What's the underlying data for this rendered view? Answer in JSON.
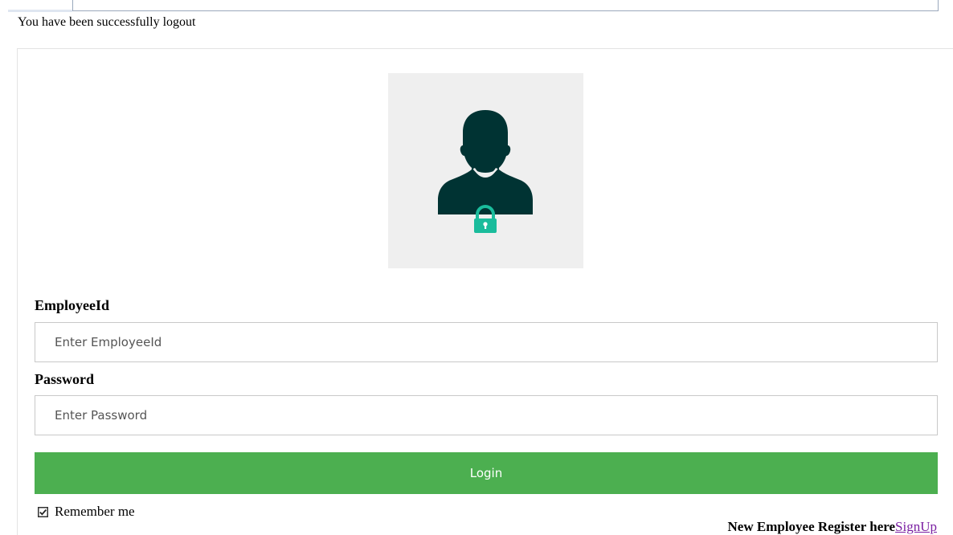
{
  "status": {
    "message": "You have been successfully logout"
  },
  "avatar": {
    "icon": "user-lock-icon",
    "colors": {
      "background": "#efefef",
      "figure": "#003333",
      "lock": "#1abc9c"
    }
  },
  "form": {
    "employee_label": "EmployeeId",
    "employee_placeholder": "Enter EmployeeId",
    "employee_value": "",
    "password_label": "Password",
    "password_placeholder": "Enter Password",
    "password_value": "",
    "login_label": "Login",
    "login_color": "#4caf50",
    "remember_label": "Remember me",
    "remember_checked": true
  },
  "signup": {
    "prompt": "New Employee Register here",
    "link_label": "SignUp"
  }
}
